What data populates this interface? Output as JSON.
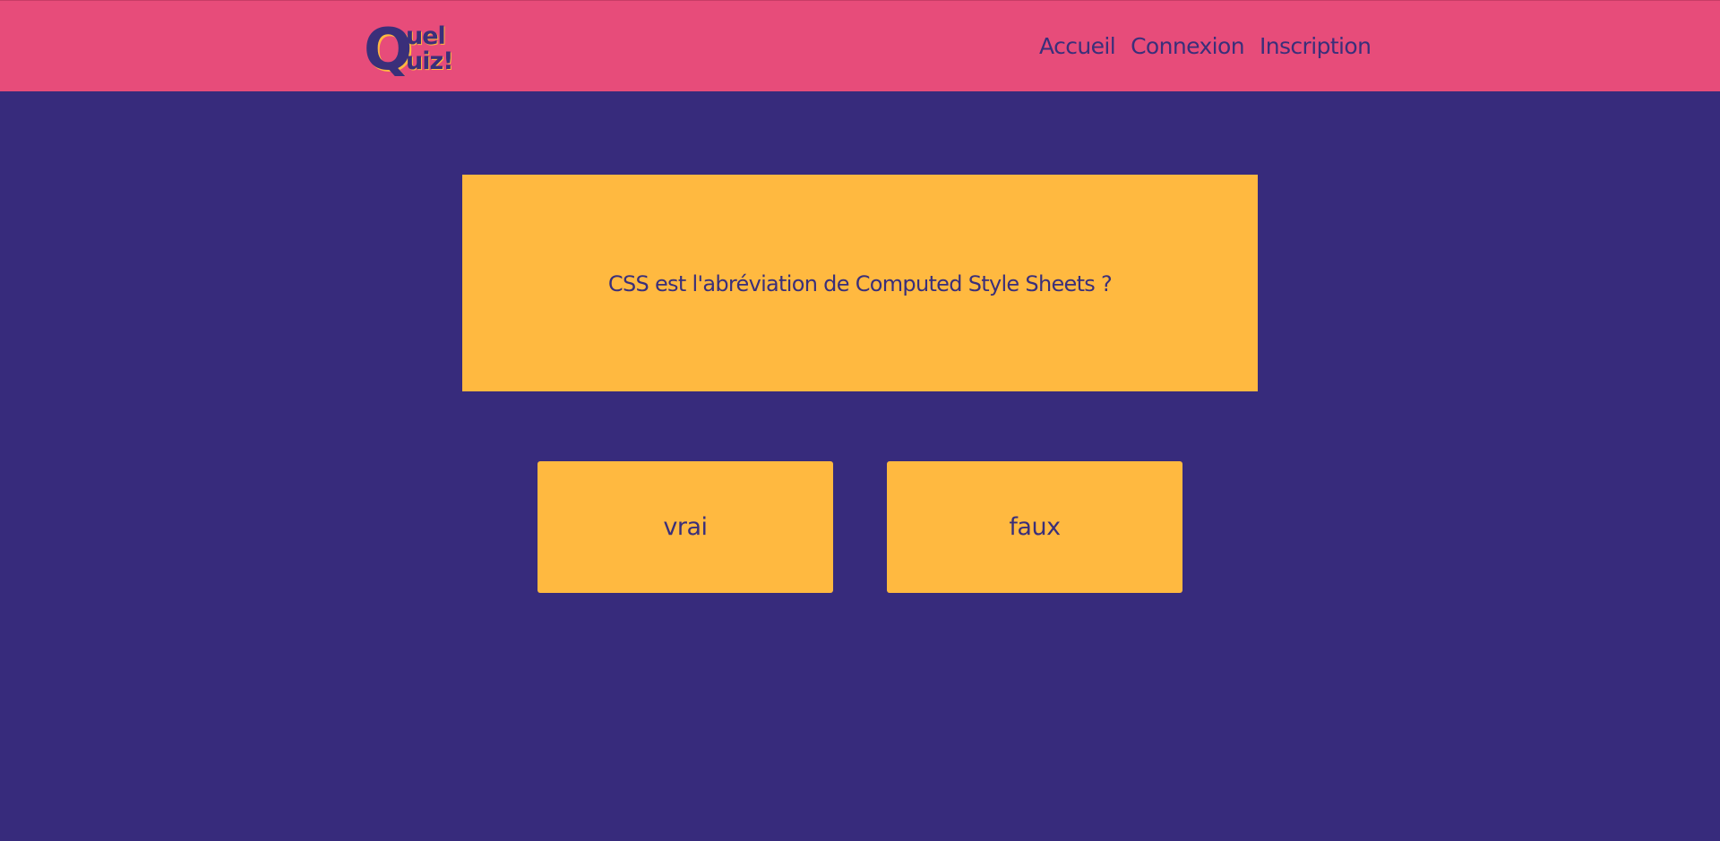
{
  "header": {
    "logo": {
      "line1_big": "Q",
      "line1_small": "uel",
      "line2_small": "uiz!"
    },
    "nav": [
      {
        "label": "Accueil"
      },
      {
        "label": "Connexion"
      },
      {
        "label": "Inscription"
      }
    ]
  },
  "quiz": {
    "question": "CSS est l'abréviation de Computed Style Sheets ?",
    "answers": [
      {
        "label": "vrai"
      },
      {
        "label": "faux"
      }
    ]
  },
  "colors": {
    "page_background": "#372b7c",
    "header_background": "#e74c7a",
    "card_background": "#ffb940",
    "text": "#3a2f7a"
  }
}
